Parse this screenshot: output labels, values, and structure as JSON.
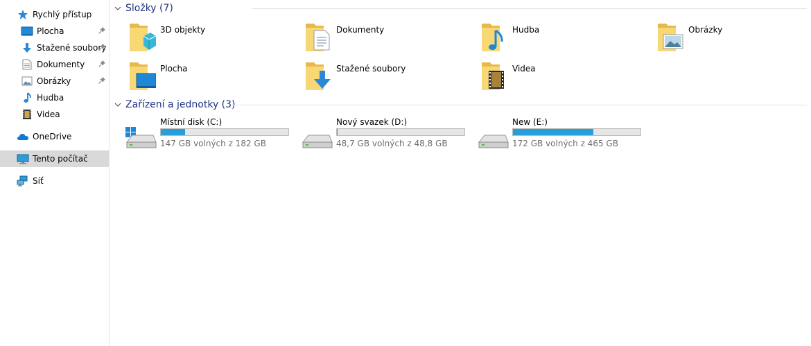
{
  "sidebar": {
    "quick_access": "Rychlý přístup",
    "items": [
      {
        "label": "Plocha",
        "icon": "desktop-icon",
        "pinned": true
      },
      {
        "label": "Stažené soubory",
        "icon": "downloads-icon",
        "pinned": true
      },
      {
        "label": "Dokumenty",
        "icon": "documents-icon",
        "pinned": true
      },
      {
        "label": "Obrázky",
        "icon": "pictures-icon",
        "pinned": true
      },
      {
        "label": "Hudba",
        "icon": "music-icon",
        "pinned": false
      },
      {
        "label": "Videa",
        "icon": "videos-icon",
        "pinned": false
      }
    ],
    "onedrive": "OneDrive",
    "this_pc": "Tento počítač",
    "network": "Síť"
  },
  "folders_group": {
    "title": "Složky (7)",
    "items": [
      {
        "name": "3D objekty",
        "icon": "3d-objects-folder-icon"
      },
      {
        "name": "Dokumenty",
        "icon": "documents-folder-icon"
      },
      {
        "name": "Hudba",
        "icon": "music-folder-icon"
      },
      {
        "name": "Obrázky",
        "icon": "pictures-folder-icon"
      },
      {
        "name": "Plocha",
        "icon": "desktop-folder-icon"
      },
      {
        "name": "Stažené soubory",
        "icon": "downloads-folder-icon"
      },
      {
        "name": "Videa",
        "icon": "videos-folder-icon"
      }
    ]
  },
  "drives_group": {
    "title": "Zařízení a jednotky (3)",
    "items": [
      {
        "name": "Místní disk (C:)",
        "free": "147 GB volných z 182 GB",
        "used_fraction": 0.19,
        "system": true
      },
      {
        "name": "Nový svazek (D:)",
        "free": "48,7 GB volných z 48,8 GB",
        "used_fraction": 0.002,
        "system": false
      },
      {
        "name": "New (E:)",
        "free": "172 GB volných z 465 GB",
        "used_fraction": 0.63,
        "system": false
      }
    ],
    "bar_color": "#26a0da"
  },
  "colors": {
    "header_blue": "#1e3287",
    "selected_bg": "#d9d9d9",
    "folder_yellow": "#f8d775"
  }
}
